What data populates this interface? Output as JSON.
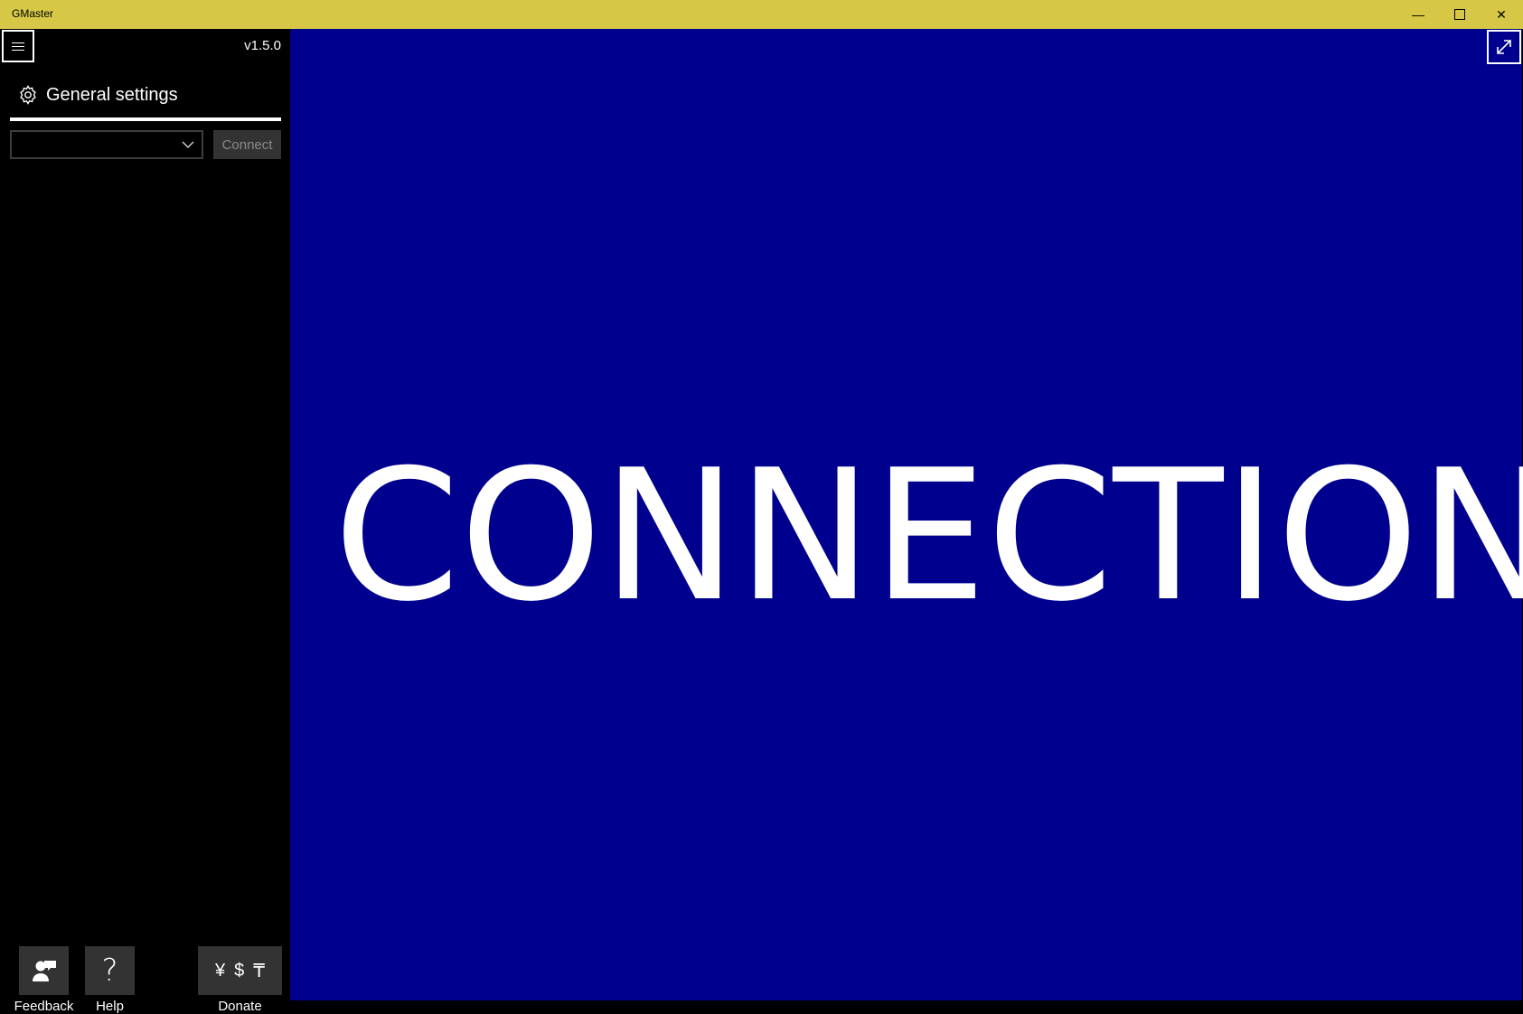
{
  "window": {
    "title": "GMaster",
    "controls": {
      "minimize": "—",
      "close": "✕"
    }
  },
  "sidebar": {
    "version": "v1.5.0",
    "settings_label": "General settings",
    "device_select": {
      "value": ""
    },
    "connect_label": "Connect",
    "bottom": {
      "feedback_label": "Feedback",
      "help_label": "Help",
      "help_glyph": "?",
      "donate_label": "Donate",
      "donate_symbols": [
        "¥",
        "$",
        "₸"
      ]
    }
  },
  "main": {
    "status_text": "CONNECTION"
  },
  "colors": {
    "titlebar": "#d6c846",
    "main_background": "#00008e",
    "sidebar_background": "#000000",
    "button_background": "#333333"
  },
  "icons": [
    "hamburger-icon",
    "gear-icon",
    "chevron-down-icon",
    "feedback-icon",
    "help-icon",
    "expand-icon"
  ]
}
